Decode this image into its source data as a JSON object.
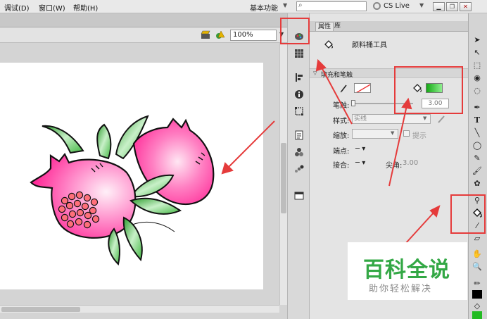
{
  "menubar": {
    "items": [
      "调试(D)",
      "窗口(W)",
      "帮助(H)"
    ],
    "workspace": "基本功能",
    "search_placeholder": "",
    "cs_live": "CS Live"
  },
  "stage": {
    "zoom": "100%"
  },
  "properties": {
    "tabs": [
      "属性",
      "库"
    ],
    "tool_name": "颜料桶工具",
    "section_title": "填充和笔触",
    "stroke_label": "笔触:",
    "stroke_value": "3.00",
    "style_label": "样式:",
    "style_value": "实线",
    "scale_label": "缩放:",
    "hint_label": "提示",
    "cap_label": "端点:",
    "join_label": "接合:",
    "miter_label": "尖角:",
    "miter_value": "3.00",
    "fill_color": "#22bb22",
    "stroke_color": "#ffffff"
  },
  "watermark": {
    "title": "百科全说",
    "subtitle": "助你轻松解决"
  },
  "colors": {
    "highlight": "#e53b3b",
    "pomegranate_pink": "#ff2d9a",
    "leaf_green": "#3fbf3f"
  }
}
